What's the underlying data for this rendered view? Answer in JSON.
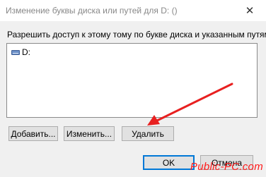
{
  "window": {
    "title": "Изменение буквы диска или путей для D: ()",
    "close_glyph": "✕"
  },
  "instruction": "Разрешить доступ к этому тому по букве диска и указанным путям.",
  "list": {
    "items": [
      {
        "label": "D:",
        "icon": "drive-icon"
      }
    ]
  },
  "buttons": {
    "add": "Добавить...",
    "change": "Изменить...",
    "delete": "Удалить",
    "ok": "OK",
    "cancel": "Отмена"
  },
  "watermark": "Public-PC.com",
  "colors": {
    "arrow": "#e82020",
    "accent": "#0078d7"
  }
}
